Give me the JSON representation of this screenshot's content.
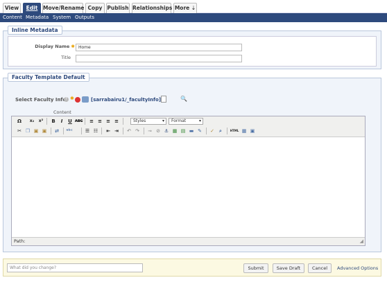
{
  "tabs": [
    {
      "label": "View",
      "active": false
    },
    {
      "label": "Edit",
      "active": true
    },
    {
      "label": "Move/Rename",
      "active": false
    },
    {
      "label": "Copy",
      "active": false
    },
    {
      "label": "Publish",
      "active": false
    },
    {
      "label": "Relationships",
      "active": false
    },
    {
      "label": "More",
      "active": false
    }
  ],
  "more_arrow": "⇣",
  "subnav": [
    "Content",
    "Metadata",
    "System",
    "Outputs"
  ],
  "inline_metadata": {
    "legend": "Inline Metadata",
    "display_name_label": "Display Name",
    "display_name_value": "Home",
    "title_label": "Title",
    "title_value": ""
  },
  "faculty": {
    "legend": "Faculty Template Default",
    "select_label": "Select Faculty Info",
    "asset_path": "[sarrabairu1/_facultyInfo]",
    "content_label": "Content"
  },
  "editor": {
    "styles": "Styles",
    "format": "Format",
    "path_label": "Path:"
  },
  "footer": {
    "change_placeholder": "What did you change?",
    "submit": "Submit",
    "save_draft": "Save Draft",
    "cancel": "Cancel",
    "advanced": "Advanced Options"
  },
  "colors": {
    "accent": "#2e4a7d",
    "panel": "#f0f4fa",
    "footer": "#fcf9e2"
  }
}
